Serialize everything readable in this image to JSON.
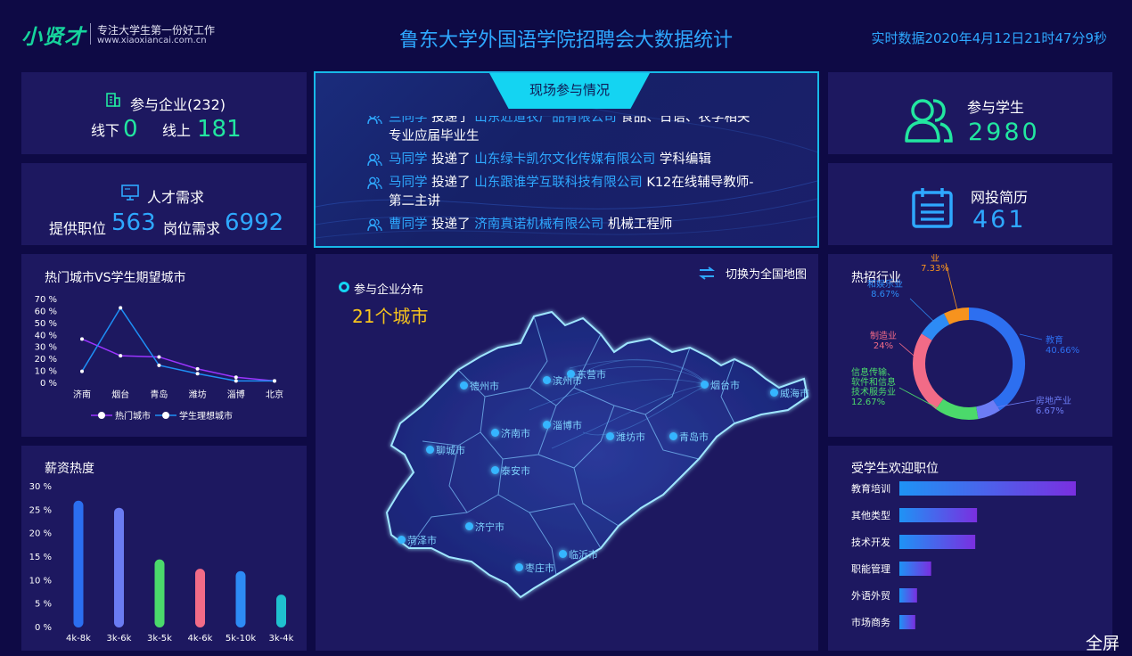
{
  "header": {
    "logo_text": "小贤才",
    "slogan": "专注大学生第一份好工作",
    "url": "www.xiaoxiancai.com.cn",
    "title": "鲁东大学外国语学院招聘会大数据统计",
    "realtime": "实时数据2020年4月12日21时47分9秒"
  },
  "enterprises": {
    "label": "参与企业(232)",
    "offline_label": "线下",
    "offline_value": "0",
    "online_label": "线上",
    "online_value": "181"
  },
  "talent": {
    "label": "人才需求",
    "positions_label": "提供职位",
    "positions_value": "563",
    "demand_label": "岗位需求",
    "demand_value": "6992"
  },
  "students": {
    "label": "参与学生",
    "value": "2980"
  },
  "resumes": {
    "label": "网投简历",
    "value": "461"
  },
  "feed": {
    "title": "现场参与情况",
    "items": [
      {
        "who": "兰同学",
        "verb": "投递了",
        "company": "山东近道农产品有限公司",
        "job": "食品、日语、农学相关专业应届毕业生"
      },
      {
        "who": "马同学",
        "verb": "投递了",
        "company": "山东绿卡凯尔文化传媒有限公司",
        "job": "学科编辑"
      },
      {
        "who": "马同学",
        "verb": "投递了",
        "company": "山东跟谁学互联科技有限公司",
        "job": "K12在线辅导教师-第二主讲"
      },
      {
        "who": "曹同学",
        "verb": "投递了",
        "company": "济南真诺机械有限公司",
        "job": "机械工程师"
      }
    ]
  },
  "map": {
    "label": "参与企业分布",
    "count": "21个城市",
    "switch_label": "切换为全国地图",
    "cities": [
      "德州市",
      "滨州市",
      "东营市",
      "烟台市",
      "威海市",
      "济南市",
      "淄博市",
      "潍坊市",
      "青岛市",
      "聊城市",
      "泰安市",
      "济宁市",
      "菏泽市",
      "临沂市",
      "枣庄市"
    ]
  },
  "fullscreen": "全屏",
  "chart_data": [
    {
      "type": "line",
      "title": "热门城市VS学生期望城市",
      "categories": [
        "济南",
        "烟台",
        "青岛",
        "潍坊",
        "淄博",
        "北京"
      ],
      "ylim": [
        0,
        70
      ],
      "yticks": [
        "0 %",
        "10 %",
        "20 %",
        "30 %",
        "40 %",
        "50 %",
        "60 %",
        "70 %"
      ],
      "series": [
        {
          "name": "热门城市",
          "values": [
            37,
            23,
            22,
            12,
            5,
            2
          ],
          "color": "#9b35ff"
        },
        {
          "name": "学生理想城市",
          "values": [
            10,
            63,
            15,
            8,
            2,
            2
          ],
          "color": "#1e8ff5"
        }
      ]
    },
    {
      "type": "bar",
      "title": "薪资热度",
      "categories": [
        "4k-8k",
        "3k-6k",
        "3k-5k",
        "4k-6k",
        "5k-10k",
        "3k-4k"
      ],
      "values": [
        27,
        25.5,
        14.5,
        12.5,
        12,
        7
      ],
      "colors": [
        "#2b6ef0",
        "#6a7bf2",
        "#4bd96b",
        "#f26b87",
        "#2d8bf5",
        "#1fc0cf"
      ],
      "ylim": [
        0,
        30
      ],
      "yticks": [
        "0 %",
        "5 %",
        "10 %",
        "15 %",
        "20 %",
        "25 %",
        "30 %"
      ]
    },
    {
      "type": "pie",
      "title": "热招行业",
      "slices": [
        {
          "label": "教育",
          "value": 40.66,
          "pct": "40.66%",
          "color": "#2d6ff0"
        },
        {
          "label": "房地产业",
          "value": 6.67,
          "pct": "6.67%",
          "color": "#6c7cf5"
        },
        {
          "label": "信息传输、软件和信息技术服务业",
          "value": 12.67,
          "pct": "12.67%",
          "color": "#4bd96b"
        },
        {
          "label": "制造业",
          "value": 24,
          "pct": "24%",
          "color": "#f26b87"
        },
        {
          "label": "文化、体育和娱乐业",
          "value": 8.67,
          "pct": "8.67%",
          "color": "#2d8bf5"
        },
        {
          "label": "业",
          "value": 7.33,
          "pct": "7.33%",
          "color": "#f7931e"
        }
      ]
    },
    {
      "type": "bar",
      "title": "受学生欢迎职位",
      "orientation": "horizontal",
      "categories": [
        "教育培训",
        "其他类型",
        "技术开发",
        "职能管理",
        "外语外贸",
        "市场商务"
      ],
      "values": [
        100,
        44,
        43,
        18,
        10,
        9
      ]
    }
  ]
}
